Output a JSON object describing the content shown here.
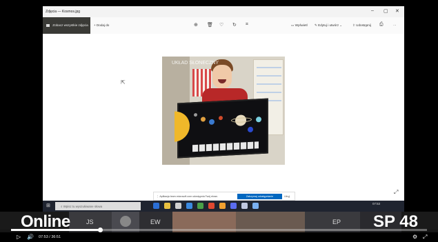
{
  "window": {
    "title": "Zdjęcia — Kosmos.jpg",
    "controls": {
      "minimize": "–",
      "maximize": "▢",
      "close": "✕"
    }
  },
  "toolbar": {
    "see_all_label": "Zobacz wszystkie zdjęcia",
    "add_to_label": "+ Dodaj do",
    "zoom_icon": "zoom-in-icon",
    "delete_icon": "trash-icon",
    "favorite_icon": "heart-icon",
    "rotate_icon": "rotate-icon",
    "crop_icon": "crop-icon",
    "print_label": "Wyświetl",
    "edit_label": "Edytuj i utwórz",
    "share_label": "Udostępnij",
    "more_label": "···"
  },
  "photo": {
    "caption": "UKŁAD SŁONECZNY"
  },
  "notification": {
    "message": "Aplikacja learn.microsoft.com udostępnia Twój ekran.",
    "primary_button": "Zatrzymaj udostępnianie",
    "secondary_button": "Ukryj"
  },
  "taskbar": {
    "search_placeholder": "Wpisz tu wyszukiwane słowa",
    "clock": "07:53"
  },
  "participants": [
    "JS",
    "EW",
    "EP"
  ],
  "overlay": {
    "left_label": "Online",
    "right_label": "SP 48"
  },
  "player": {
    "current_time": "07:53",
    "separator": "/",
    "duration": "36:51",
    "progress_fraction": 0.214
  }
}
